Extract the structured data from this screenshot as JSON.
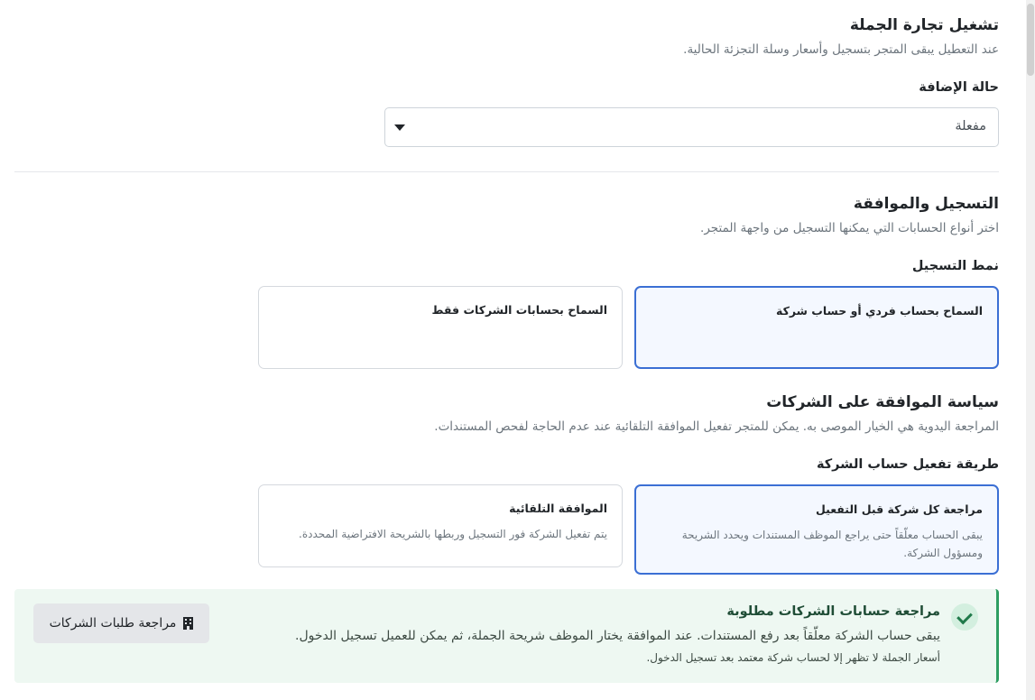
{
  "wholesale": {
    "title": "تشغيل تجارة الجملة",
    "description": "عند التعطيل يبقى المتجر بتسجيل وأسعار وسلة التجزئة الحالية.",
    "status_label": "حالة الإضافة",
    "status_value": "مفعلة"
  },
  "registration": {
    "title": "التسجيل والموافقة",
    "description": "اختر أنواع الحسابات التي يمكنها التسجيل من واجهة المتجر.",
    "mode_label": "نمط التسجيل",
    "options": [
      {
        "title": "السماح بحساب فردي أو حساب شركة",
        "selected": true
      },
      {
        "title": "السماح بحسابات الشركات فقط",
        "selected": false
      }
    ]
  },
  "approval": {
    "title": "سياسة الموافقة على الشركات",
    "description": "المراجعة اليدوية هي الخيار الموصى به. يمكن للمتجر تفعيل الموافقة التلقائية عند عدم الحاجة لفحص المستندات.",
    "method_label": "طريقة تفعيل حساب الشركة",
    "options": [
      {
        "title": "مراجعة كل شركة قبل التفعيل",
        "description": "يبقى الحساب معلّقاً حتى يراجع الموظف المستندات ويحدد الشريحة ومسؤول الشركة.",
        "selected": true
      },
      {
        "title": "الموافقة التلقائية",
        "description": "يتم تفعيل الشركة فور التسجيل وربطها بالشريحة الافتراضية المحددة.",
        "selected": false
      }
    ]
  },
  "alert": {
    "title": "مراجعة حسابات الشركات مطلوبة",
    "text": "يبقى حساب الشركة معلّقاً بعد رفع المستندات. عند الموافقة يختار الموظف شريحة الجملة، ثم يمكن للعميل تسجيل الدخول.",
    "note": "أسعار الجملة لا تظهر إلا لحساب شركة معتمد بعد تسجيل الدخول.",
    "button_label": "مراجعة طلبات الشركات",
    "button_icon": "building-icon",
    "check_icon": "check-icon"
  },
  "colors": {
    "accent": "#3b6fd4",
    "success": "#2e9e62",
    "alert_bg": "#eef8f2"
  }
}
